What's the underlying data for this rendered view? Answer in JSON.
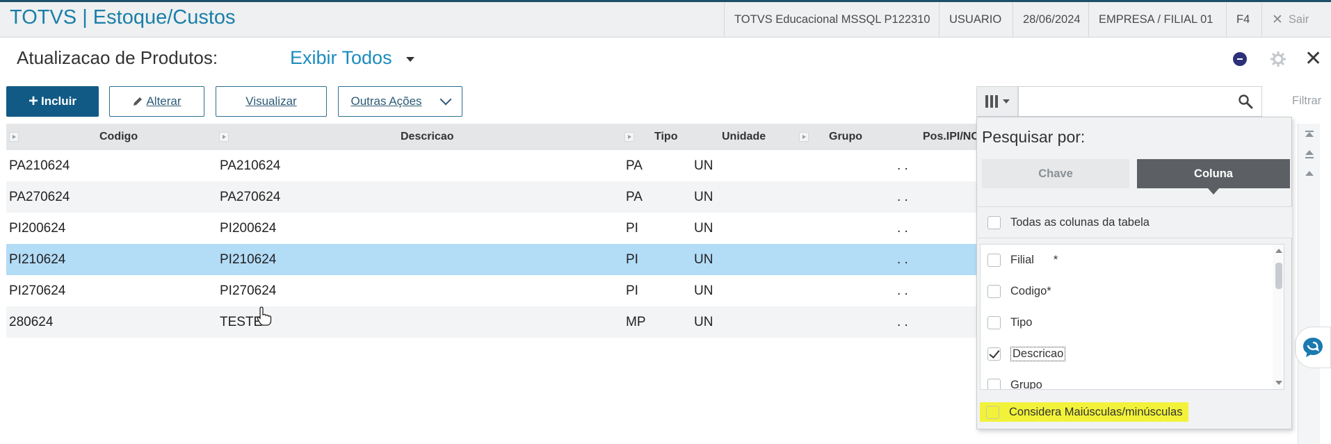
{
  "app": {
    "title": "TOTVS | Estoque/Custos",
    "environment": "TOTVS Educacional MSSQL P122310",
    "user": "USUARIO",
    "date": "28/06/2024",
    "company": "EMPRESA / FILIAL 01",
    "shortcut": "F4",
    "exit_label": "Sair",
    "exit_icon": "close-icon"
  },
  "page": {
    "title": "Atualizacao de Produtos:",
    "view_filter": "Exibir Todos"
  },
  "toolbar": {
    "include_label": "Incluir",
    "include_hotkey": "I",
    "alter_label": "Alterar",
    "view_label": "Visualizar",
    "more_label": "Outras Ações"
  },
  "search": {
    "value": "",
    "filter_label": "Filtrar"
  },
  "table": {
    "columns": [
      "Codigo",
      "Descricao",
      "Tipo",
      "Unidade",
      "Grupo",
      "Pos.IPI/NC"
    ],
    "rows": [
      {
        "codigo": "PA210624",
        "descricao": "PA210624",
        "tipo": "PA",
        "unidade": "UN",
        "grupo": "",
        "pos": ". ."
      },
      {
        "codigo": "PA270624",
        "descricao": "PA270624",
        "tipo": "PA",
        "unidade": "UN",
        "grupo": "",
        "pos": ". ."
      },
      {
        "codigo": "PI200624",
        "descricao": "PI200624",
        "tipo": "PI",
        "unidade": "UN",
        "grupo": "",
        "pos": ". ."
      },
      {
        "codigo": "PI210624",
        "descricao": "PI210624",
        "tipo": "PI",
        "unidade": "UN",
        "grupo": "",
        "pos": ". ."
      },
      {
        "codigo": "PI270624",
        "descricao": "PI270624",
        "tipo": "PI",
        "unidade": "UN",
        "grupo": "",
        "pos": ". ."
      },
      {
        "codigo": "280624",
        "descricao": "TESTE",
        "tipo": "MP",
        "unidade": "UN",
        "grupo": "",
        "pos": ". ."
      }
    ],
    "selected_index": 3
  },
  "search_panel": {
    "title": "Pesquisar por:",
    "tabs": [
      "Chave",
      "Coluna"
    ],
    "active_tab": "Coluna",
    "all_columns_label": "Todas as colunas da tabela",
    "columns": [
      {
        "label": "Filial",
        "suffix": "*",
        "checked": false
      },
      {
        "label": "Codigo*",
        "suffix": "",
        "checked": false
      },
      {
        "label": "Tipo",
        "suffix": "",
        "checked": false
      },
      {
        "label": "Descricao",
        "suffix": "",
        "checked": true
      },
      {
        "label": "Grupo",
        "suffix": "",
        "checked": false
      }
    ],
    "case_label": "Considera Maiúsculas/minúsculas",
    "highlight_color": "#f2f23a"
  },
  "colors": {
    "title_blue": "#1a7ea8",
    "primary_button": "#115a86",
    "selected_row": "#b3dcf7",
    "tab_active": "#5c6064"
  }
}
